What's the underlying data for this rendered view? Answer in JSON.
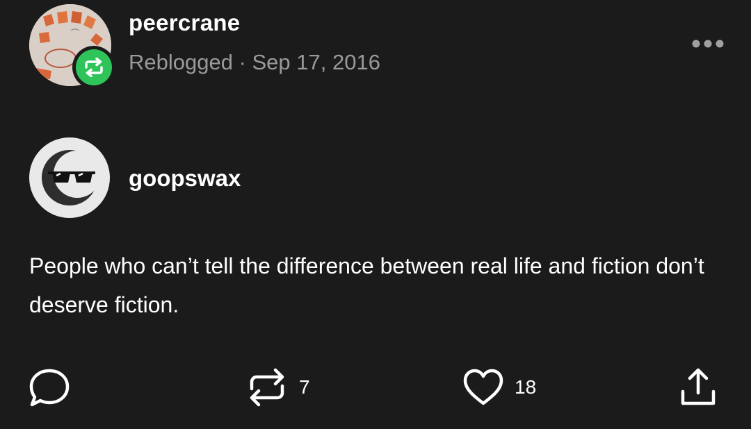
{
  "reblogger": {
    "name": "peercrane",
    "meta": "Reblogged · Sep 17, 2016",
    "avatar_icon": "sketch-avatar",
    "badge_icon": "reblog-icon",
    "badge_color": "#2fc45a"
  },
  "menu": {
    "icon": "more-options-icon"
  },
  "author": {
    "name": "goopswax",
    "avatar_icon": "sunglasses-moon-icon"
  },
  "post": {
    "text": "People who can’t tell the difference between real life and fiction don’t deserve fiction."
  },
  "actions": {
    "reply_icon": "reply-icon",
    "reblog_icon": "reblog-icon",
    "reblog_count": "7",
    "like_icon": "heart-icon",
    "like_count": "18",
    "share_icon": "share-icon"
  },
  "colors": {
    "background": "#1b1b1b",
    "text": "#ffffff",
    "secondary_text": "#9a9a9a"
  }
}
